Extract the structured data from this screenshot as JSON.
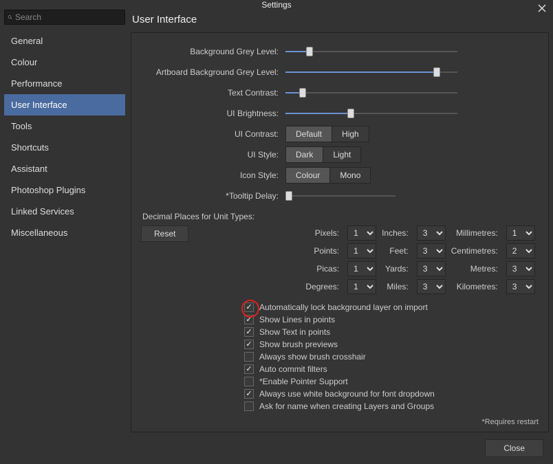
{
  "window": {
    "title": "Settings",
    "close_label": "Close"
  },
  "search": {
    "placeholder": "Search"
  },
  "nav": {
    "items": [
      {
        "label": "General"
      },
      {
        "label": "Colour"
      },
      {
        "label": "Performance"
      },
      {
        "label": "User Interface",
        "selected": true
      },
      {
        "label": "Tools"
      },
      {
        "label": "Shortcuts"
      },
      {
        "label": "Assistant"
      },
      {
        "label": "Photoshop Plugins"
      },
      {
        "label": "Linked Services"
      },
      {
        "label": "Miscellaneous"
      }
    ]
  },
  "page": {
    "title": "User Interface"
  },
  "sliders": {
    "bg_grey": {
      "label": "Background Grey Level:",
      "percent": 14
    },
    "artboard_bg": {
      "label": "Artboard Background Grey Level:",
      "percent": 88
    },
    "text_contrast": {
      "label": "Text Contrast:",
      "percent": 10
    },
    "ui_brightness": {
      "label": "UI Brightness:",
      "percent": 38
    },
    "tooltip_delay": {
      "label": "*Tooltip Delay:",
      "percent": 3,
      "short": true
    }
  },
  "segments": {
    "ui_contrast": {
      "label": "UI Contrast:",
      "options": [
        "Default",
        "High"
      ],
      "active": 0
    },
    "ui_style": {
      "label": "UI Style:",
      "options": [
        "Dark",
        "Light"
      ],
      "active": 0
    },
    "icon_style": {
      "label": "Icon Style:",
      "options": [
        "Colour",
        "Mono"
      ],
      "active": 0
    }
  },
  "units": {
    "section_label": "Decimal Places for Unit Types:",
    "reset_label": "Reset",
    "items": [
      {
        "label": "Pixels:",
        "value": "1"
      },
      {
        "label": "Inches:",
        "value": "3"
      },
      {
        "label": "Millimetres:",
        "value": "1"
      },
      {
        "label": "Points:",
        "value": "1"
      },
      {
        "label": "Feet:",
        "value": "3"
      },
      {
        "label": "Centimetres:",
        "value": "2"
      },
      {
        "label": "Picas:",
        "value": "1"
      },
      {
        "label": "Yards:",
        "value": "3"
      },
      {
        "label": "Metres:",
        "value": "3"
      },
      {
        "label": "Degrees:",
        "value": "1"
      },
      {
        "label": "Miles:",
        "value": "3"
      },
      {
        "label": "Kilometres:",
        "value": "3"
      }
    ]
  },
  "checks": [
    {
      "label": "Automatically lock background layer on import",
      "checked": true,
      "highlighted": true
    },
    {
      "label": "Show Lines in points",
      "checked": true
    },
    {
      "label": "Show Text in points",
      "checked": true
    },
    {
      "label": "Show brush previews",
      "checked": true
    },
    {
      "label": "Always show brush crosshair",
      "checked": false
    },
    {
      "label": "Auto commit filters",
      "checked": true
    },
    {
      "label": "*Enable Pointer Support",
      "checked": false
    },
    {
      "label": "Always use white background for font dropdown",
      "checked": true
    },
    {
      "label": "Ask for name when creating Layers and Groups",
      "checked": false
    }
  ],
  "requires_note": "*Requires restart"
}
